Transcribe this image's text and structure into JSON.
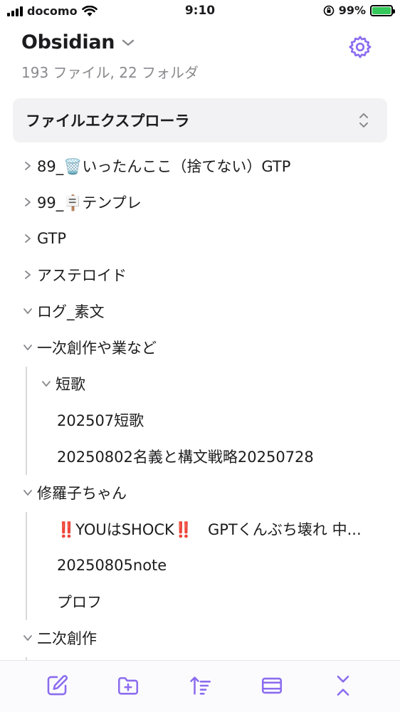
{
  "status_bar": {
    "carrier": "docomo",
    "time": "9:10",
    "battery_percent": "99%"
  },
  "vault": {
    "name": "Obsidian",
    "stats": "193 ファイル, 22 フォルダ"
  },
  "explorer": {
    "view_label": "ファイルエクスプローラ"
  },
  "tree": [
    {
      "label": "89_🗑️いったんここ（捨てない）GTP",
      "type": "folder",
      "expanded": false,
      "depth": 0
    },
    {
      "label": "99_🪧テンプレ",
      "type": "folder",
      "expanded": false,
      "depth": 0
    },
    {
      "label": "GTP",
      "type": "folder",
      "expanded": false,
      "depth": 0
    },
    {
      "label": "アステロイド",
      "type": "folder",
      "expanded": false,
      "depth": 0
    },
    {
      "label": "ログ_素文",
      "type": "folder",
      "expanded": true,
      "depth": 0
    },
    {
      "label": "一次創作や業など",
      "type": "folder",
      "expanded": true,
      "depth": 0
    },
    {
      "label": "短歌",
      "type": "folder",
      "expanded": true,
      "depth": 1
    },
    {
      "label": "202507短歌",
      "type": "file",
      "depth": 1
    },
    {
      "label": "20250802名義と構文戦略20250728",
      "type": "file",
      "depth": 1
    },
    {
      "label": "修羅子ちゃん",
      "type": "folder",
      "expanded": true,
      "depth": 0
    },
    {
      "label": "‼️YOUはSHOCK‼️　GPTくんぶち壊れ 中...",
      "type": "file",
      "depth": 1
    },
    {
      "label": "20250805note",
      "type": "file",
      "depth": 1
    },
    {
      "label": "プロフ",
      "type": "file",
      "depth": 1
    },
    {
      "label": "二次創作",
      "type": "folder",
      "expanded": true,
      "depth": 0
    }
  ],
  "toolbar": {
    "accent_color": "#8b6cef",
    "icons": [
      "new-note-icon",
      "new-folder-icon",
      "sort-icon",
      "collapse-view-icon",
      "collapse-all-icon"
    ]
  }
}
